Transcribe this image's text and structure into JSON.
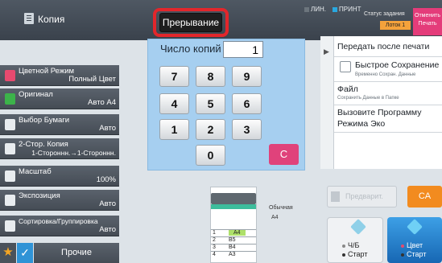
{
  "header": {
    "app_title": "Копия",
    "interrupt_label": "Прерывание",
    "indicators": [
      {
        "label": "ЛИН.",
        "color": "#6c757d"
      },
      {
        "label": "ПРИНТ",
        "color": "#29a8e0"
      }
    ],
    "job_status_label": "Статус задания",
    "tray_badge": "Лоток 1",
    "cancel_print_label_1": "Отменить",
    "cancel_print_label_2": "Печать"
  },
  "sidebar": {
    "items": [
      {
        "title": "Цветной Режим",
        "value": "Полный Цвет",
        "icon": "color-mode-icon",
        "color": "#e64a6f"
      },
      {
        "title": "Оригинал",
        "value": "Авто  A4",
        "icon": "original-icon",
        "color": "#3cb34a"
      },
      {
        "title": "Выбор Бумаги",
        "value": "Авто",
        "icon": "paper-select-icon",
        "color": "#e8ecef"
      },
      {
        "title": "2-Стор. Копия",
        "value": "1-Стороннн.→1-Стороннн.",
        "icon": "duplex-icon",
        "color": "#e8ecef"
      },
      {
        "title": "Масштаб",
        "value": "100%",
        "icon": "zoom-icon",
        "color": "#e8ecef"
      },
      {
        "title": "Экспозиция",
        "value": "Авто",
        "icon": "exposure-icon",
        "color": "#e8ecef"
      },
      {
        "title": "Сортировка/Группировка",
        "value": "Авто",
        "icon": "sort-icon",
        "color": "#e8ecef"
      }
    ],
    "other_label": "Прочие"
  },
  "keypad": {
    "copies_label": "Число копий",
    "copies_value": "1",
    "keys": [
      "7",
      "8",
      "9",
      "4",
      "5",
      "6",
      "1",
      "2",
      "3",
      "0"
    ],
    "clear_label": "C"
  },
  "right_panel": {
    "send_after_print": "Передать после печати",
    "quick_save": "Быстрое Сохранение",
    "quick_save_sub": "Временно Сохран. Данные",
    "file": "Файл",
    "file_sub": "Сохранить Данные в Папке",
    "eco_line1": "Вызовите Программу",
    "eco_line2": "Режима Эко"
  },
  "preview": {
    "paper_type": "Обычная",
    "paper_size": "A4",
    "trays": [
      {
        "num": "1",
        "size": "A4"
      },
      {
        "num": "2",
        "size": "B5"
      },
      {
        "num": "3",
        "size": "B4"
      },
      {
        "num": "4",
        "size": "A3"
      }
    ]
  },
  "actions": {
    "preview_label": "Предварит.",
    "ca_label": "CA",
    "bw_start_line1": "Ч/Б",
    "bw_start_line2": "Старт",
    "color_start_line1": "Цвет",
    "color_start_line2": "Старт"
  }
}
